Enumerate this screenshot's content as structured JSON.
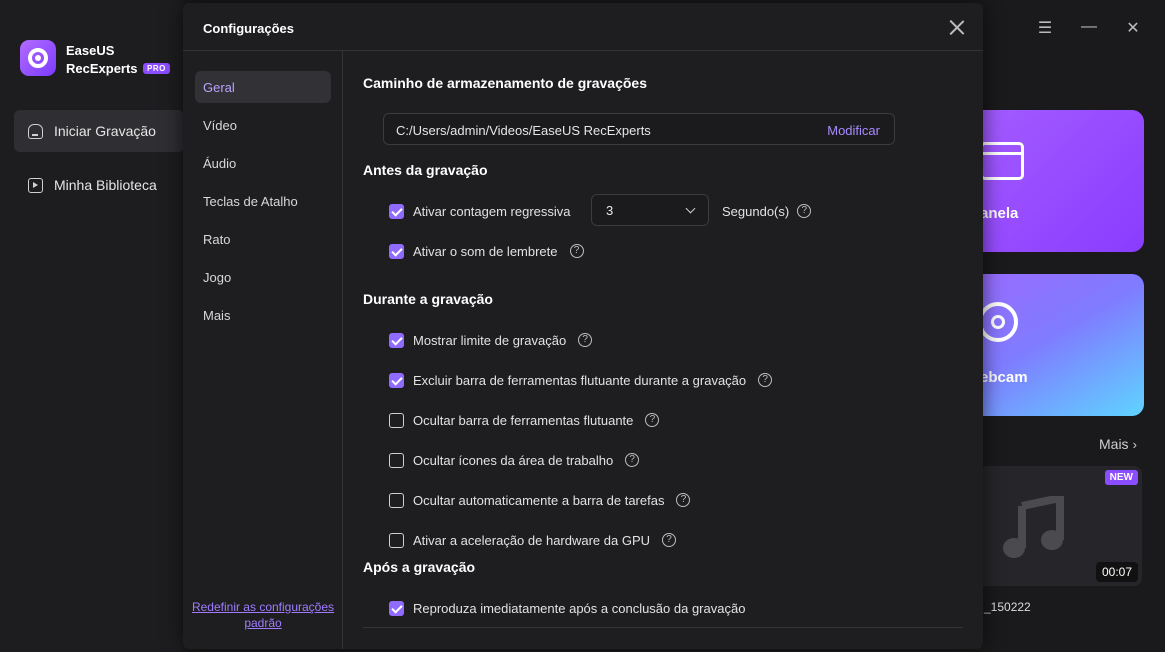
{
  "app": {
    "brand_line1": "EaseUS",
    "brand_line2": "RecExperts",
    "pro_badge": "PRO",
    "nav": [
      {
        "label": "Iniciar Gravação",
        "icon": "home-icon",
        "active": true
      },
      {
        "label": "Minha Biblioteca",
        "icon": "library-icon",
        "active": false
      }
    ],
    "cards": [
      {
        "label": "anela",
        "icon": "window-icon"
      },
      {
        "label": "ebcam",
        "icon": "webcam-icon"
      }
    ],
    "more_label": "Mais",
    "recent": {
      "badge": "NEW",
      "duration": "00:07",
      "name": "_150222",
      "icon": "music-note-icon"
    }
  },
  "settings": {
    "title": "Configurações",
    "menu": [
      {
        "label": "Geral",
        "active": true
      },
      {
        "label": "Vídeo",
        "active": false
      },
      {
        "label": "Áudio",
        "active": false
      },
      {
        "label": "Teclas de Atalho",
        "active": false
      },
      {
        "label": "Rato",
        "active": false
      },
      {
        "label": "Jogo",
        "active": false
      },
      {
        "label": "Mais",
        "active": false
      }
    ],
    "reset_label": "Redefinir as configurações padrão",
    "storage": {
      "title": "Caminho de armazenamento de gravações",
      "path": "C:/Users/admin/Videos/EaseUS RecExperts",
      "modify_label": "Modificar"
    },
    "before": {
      "title": "Antes da gravação",
      "countdown_label": "Ativar contagem regressiva",
      "countdown_checked": true,
      "countdown_value": "3",
      "seconds_label": "Segundo(s)",
      "reminder_label": "Ativar o som de lembrete",
      "reminder_checked": true
    },
    "during": {
      "title": "Durante a gravação",
      "options": [
        {
          "label": "Mostrar limite de gravação",
          "checked": true
        },
        {
          "label": "Excluir barra de ferramentas flutuante durante a gravação",
          "checked": true
        },
        {
          "label": "Ocultar barra de ferramentas flutuante",
          "checked": false
        },
        {
          "label": "Ocultar ícones da área de trabalho",
          "checked": false
        },
        {
          "label": "Ocultar automaticamente a barra de tarefas",
          "checked": false
        },
        {
          "label": "Ativar a aceleração de hardware da GPU",
          "checked": false
        }
      ]
    },
    "after": {
      "title": "Após a gravação",
      "option_label": "Reproduza imediatamente após a conclusão da gravação",
      "option_checked": true
    }
  },
  "colors": {
    "accent": "#8f6bff",
    "link": "#a88bff"
  }
}
